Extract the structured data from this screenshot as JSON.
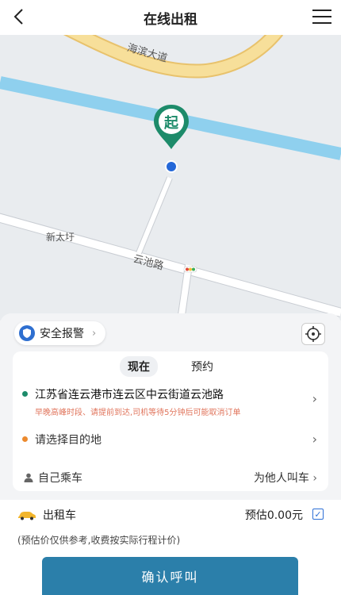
{
  "header": {
    "title": "在线出租"
  },
  "map": {
    "labels": {
      "haibin": "海滨大道",
      "xintai": "新太圩",
      "yunchi": "云池路"
    },
    "pin_text": "起"
  },
  "safety": {
    "label": "安全报警"
  },
  "tabs": [
    {
      "label": "现在"
    },
    {
      "label": "预约"
    }
  ],
  "trip": {
    "origin": "江苏省连云港市连云区中云街道云池路",
    "origin_hint": "早晚高峰时段、请提前到达,司机等待5分钟后可能取消订单",
    "destination_placeholder": "请选择目的地",
    "rider_self": "自己乘车",
    "rider_other": "为他人叫车"
  },
  "service": {
    "name": "出租车",
    "estimate": "预估0.00元",
    "checked": true,
    "note": "(预估价仅供参考,收费按实际行程计价)"
  },
  "confirm_label": "确认呼叫",
  "colors": {
    "accent": "#2b7faa",
    "pin": "#1d8b6a",
    "river": "#8fd0ee",
    "road_main": "#f7d98a"
  }
}
